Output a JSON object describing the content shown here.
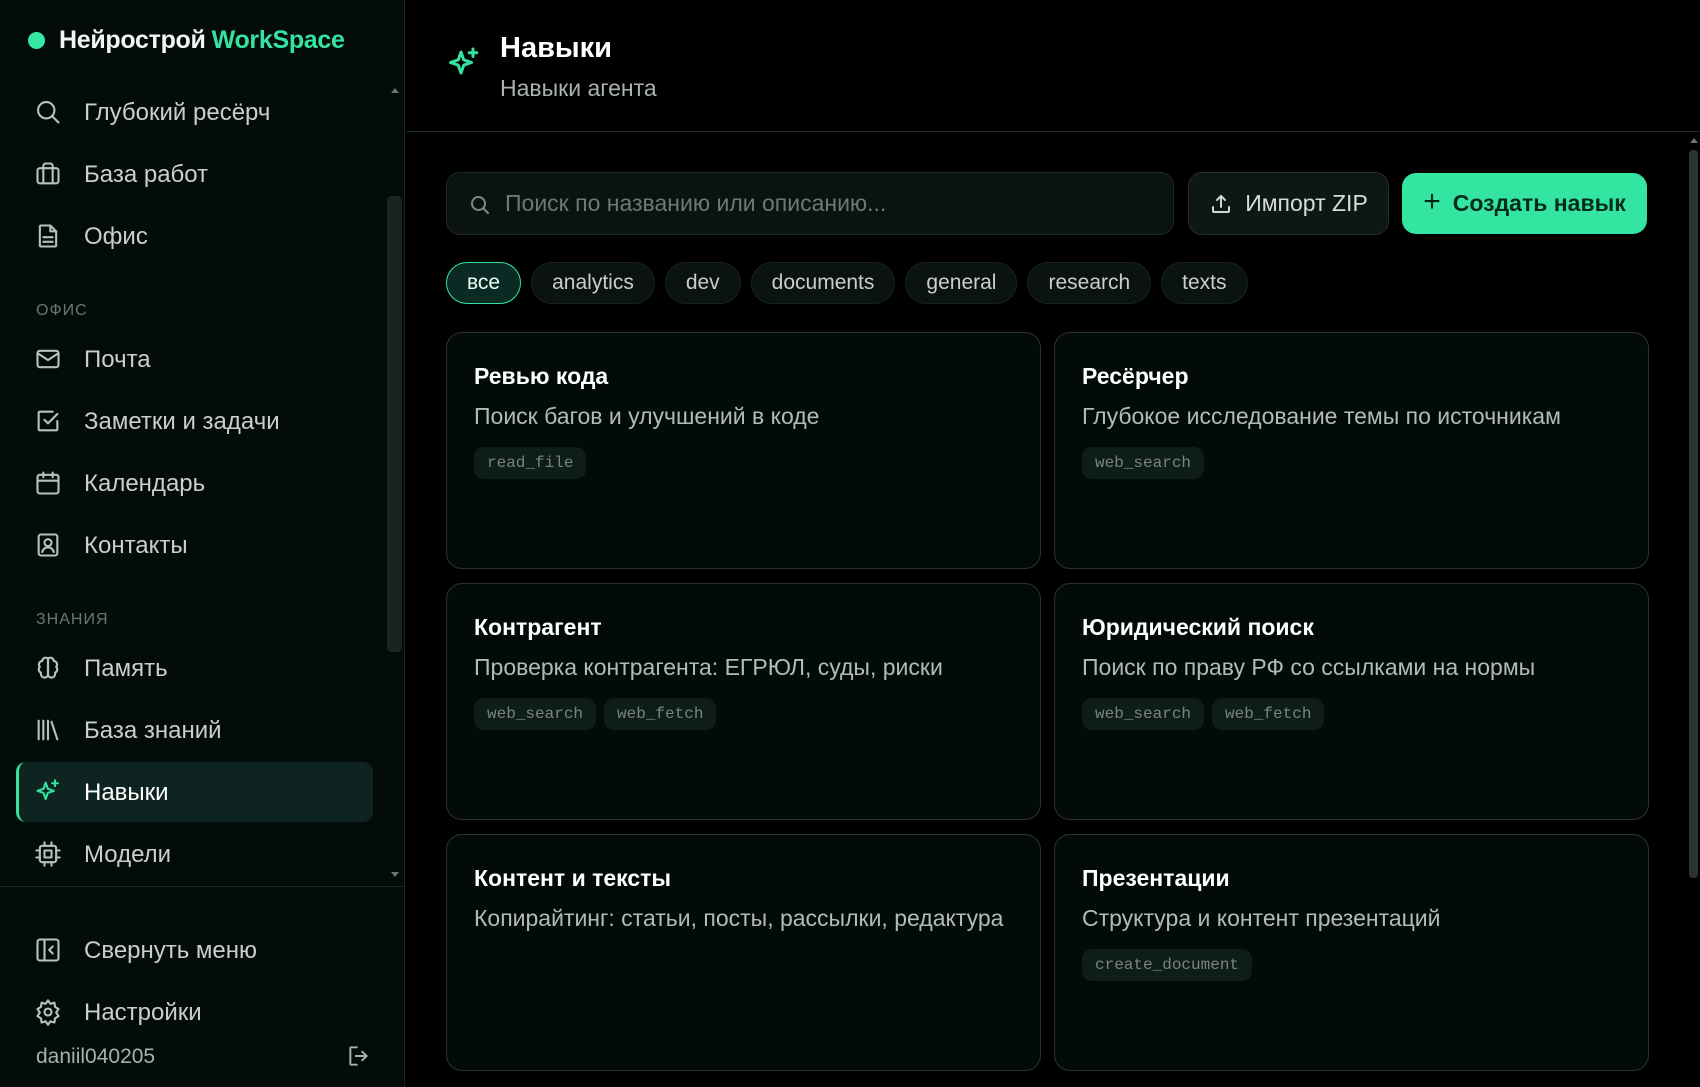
{
  "brand": {
    "name": "Нейрострой",
    "accent": "WorkSpace",
    "dot_color": "#37e7a4"
  },
  "sidebar": {
    "top_items": [
      {
        "label": "Глубокий ресёрч",
        "icon": "search-icon"
      },
      {
        "label": "База работ",
        "icon": "briefcase-icon"
      },
      {
        "label": "Офис",
        "icon": "document-icon"
      }
    ],
    "sections": [
      {
        "title": "ОФИС",
        "items": [
          {
            "label": "Почта",
            "icon": "mail-icon"
          },
          {
            "label": "Заметки и задачи",
            "icon": "checkbox-icon"
          },
          {
            "label": "Календарь",
            "icon": "calendar-icon"
          },
          {
            "label": "Контакты",
            "icon": "contact-icon"
          }
        ]
      },
      {
        "title": "ЗНАНИЯ",
        "items": [
          {
            "label": "Память",
            "icon": "brain-icon"
          },
          {
            "label": "База знаний",
            "icon": "library-icon"
          },
          {
            "label": "Навыки",
            "icon": "sparkle-icon",
            "active": true
          },
          {
            "label": "Модели",
            "icon": "chip-icon"
          }
        ]
      }
    ],
    "bottom_items": [
      {
        "label": "Свернуть меню",
        "icon": "collapse-icon"
      },
      {
        "label": "Настройки",
        "icon": "gear-icon"
      }
    ],
    "user": "daniil040205"
  },
  "header": {
    "title": "Навыки",
    "subtitle": "Навыки агента",
    "icon": "sparkle-icon"
  },
  "toolbar": {
    "search_placeholder": "Поиск по названию или описанию...",
    "import_label": "Импорт ZIP",
    "create_label": "Создать навык",
    "accent_color": "#34e5a2"
  },
  "filters": [
    {
      "label": "все",
      "active": true
    },
    {
      "label": "analytics"
    },
    {
      "label": "dev"
    },
    {
      "label": "documents"
    },
    {
      "label": "general"
    },
    {
      "label": "research"
    },
    {
      "label": "texts"
    }
  ],
  "skills": [
    {
      "title": "Ревью кода",
      "description": "Поиск багов и улучшений в коде",
      "tools": [
        "read_file"
      ]
    },
    {
      "title": "Ресёрчер",
      "description": "Глубокое исследование темы по источникам",
      "tools": [
        "web_search"
      ]
    },
    {
      "title": "Контрагент",
      "description": "Проверка контрагента: ЕГРЮЛ, суды, риски",
      "tools": [
        "web_search",
        "web_fetch"
      ]
    },
    {
      "title": "Юридический поиск",
      "description": "Поиск по праву РФ со ссылками на нормы",
      "tools": [
        "web_search",
        "web_fetch"
      ]
    },
    {
      "title": "Контент и тексты",
      "description": "Копирайтинг: статьи, посты, рассылки, редактура",
      "tools": []
    },
    {
      "title": "Презентации",
      "description": "Структура и контент презентаций",
      "tools": [
        "create_document"
      ]
    }
  ]
}
